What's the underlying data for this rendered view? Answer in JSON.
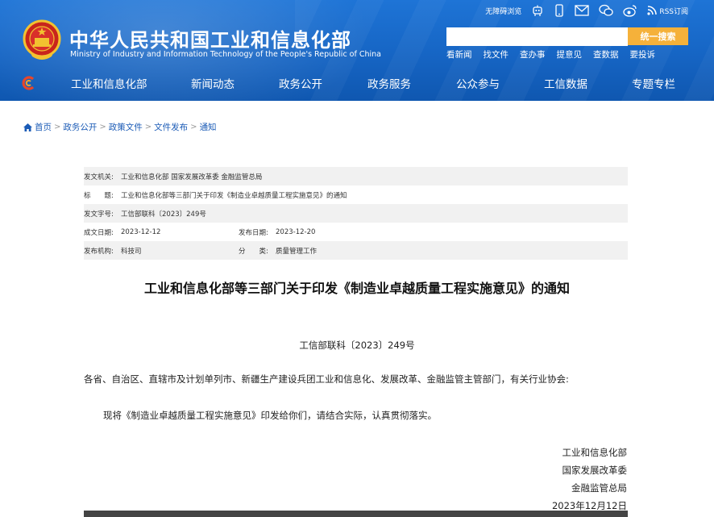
{
  "header": {
    "title": "中华人民共和国工业和信息化部",
    "subtitle": "Ministry of Industry and Information Technology of the People's Republic of China",
    "top_links": {
      "accessible": "无障碍浏览",
      "rss": "RSS订阅"
    },
    "search": {
      "value": "",
      "placeholder": "",
      "button_label": "统一搜索"
    },
    "quick_links": [
      "看新闻",
      "找文件",
      "查办事",
      "提意见",
      "查数据",
      "要投诉"
    ],
    "nav": [
      "工业和信息化部",
      "新闻动态",
      "政务公开",
      "政务服务",
      "公众参与",
      "工信数据",
      "专题专栏"
    ]
  },
  "breadcrumb": [
    "首页",
    "政务公开",
    "政策文件",
    "文件发布",
    "通知"
  ],
  "info": {
    "issuer_label": "发文机关:",
    "issuer": "工业和信息化部 国家发展改革委 金融监管总局",
    "title_label": "标　　题:",
    "title": "工业和信息化部等三部门关于印发《制造业卓越质量工程实施意见》的通知",
    "docno_label": "发文字号:",
    "docno": "工信部联科〔2023〕249号",
    "created_label": "成文日期:",
    "created": "2023-12-12",
    "published_label": "发布日期:",
    "published": "2023-12-20",
    "org_label": "发布机构:",
    "org": "科技司",
    "category_label": "分　　类:",
    "category": "质量管理工作"
  },
  "document": {
    "title": "工业和信息化部等三部门关于印发《制造业卓越质量工程实施意见》的通知",
    "number": "工信部联科〔2023〕249号",
    "addressee": "各省、自治区、直辖市及计划单列市、新疆生产建设兵团工业和信息化、发展改革、金融监管主管部门，有关行业协会:",
    "body": "现将《制造业卓越质量工程实施意见》印发给你们，请结合实际，认真贯彻落实。",
    "signers": [
      "工业和信息化部",
      "国家发展改革委",
      "金融监管总局",
      "2023年12月12日"
    ]
  },
  "colors": {
    "header_blue": "#1665c4",
    "search_button": "#f5b13a",
    "link_blue": "#1b5bb6"
  }
}
